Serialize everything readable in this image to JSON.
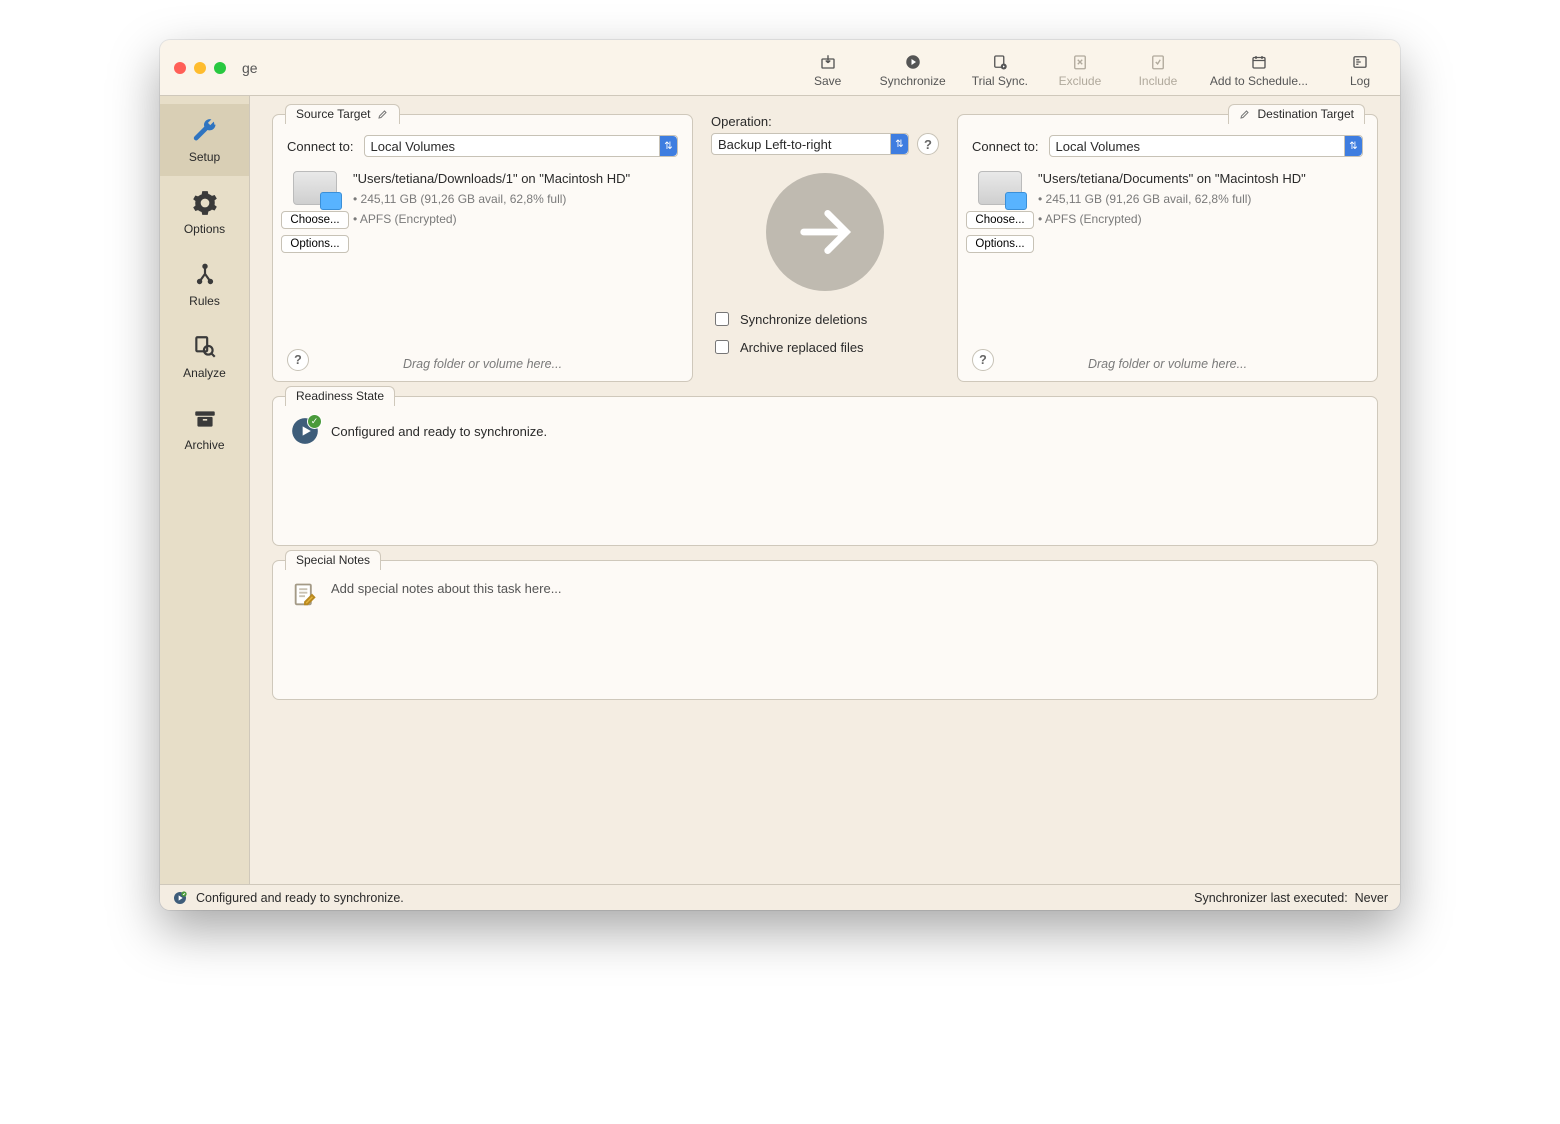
{
  "window": {
    "title": "ge"
  },
  "toolbar": {
    "save": "Save",
    "synchronize": "Synchronize",
    "trial": "Trial Sync.",
    "exclude": "Exclude",
    "include": "Include",
    "schedule": "Add to Schedule...",
    "log": "Log"
  },
  "sidebar": {
    "items": [
      {
        "label": "Setup"
      },
      {
        "label": "Options"
      },
      {
        "label": "Rules"
      },
      {
        "label": "Analyze"
      },
      {
        "label": "Archive"
      }
    ]
  },
  "source": {
    "tab": "Source Target",
    "connect_label": "Connect to:",
    "connect_value": "Local Volumes",
    "path": "\"Users/tetiana/Downloads/1\" on \"Macintosh HD\"",
    "meta1": "• 245,11 GB (91,26 GB avail, 62,8% full)",
    "meta2": "• APFS (Encrypted)",
    "choose": "Choose...",
    "options": "Options...",
    "hint": "Drag folder or volume here..."
  },
  "dest": {
    "tab": "Destination Target",
    "connect_label": "Connect to:",
    "connect_value": "Local Volumes",
    "path": "\"Users/tetiana/Documents\" on \"Macintosh HD\"",
    "meta1": "• 245,11 GB (91,26 GB avail, 62,8% full)",
    "meta2": "• APFS (Encrypted)",
    "choose": "Choose...",
    "options": "Options...",
    "hint": "Drag folder or volume here..."
  },
  "operation": {
    "label": "Operation:",
    "value": "Backup Left-to-right",
    "sync_del": "Synchronize deletions",
    "archive_replaced": "Archive replaced files"
  },
  "readiness": {
    "tab": "Readiness State",
    "text": "Configured and ready to synchronize."
  },
  "notes": {
    "tab": "Special Notes",
    "placeholder": "Add special notes about this task here..."
  },
  "status": {
    "text": "Configured and ready to synchronize.",
    "last_label": "Synchronizer last executed:",
    "last_value": "Never"
  }
}
